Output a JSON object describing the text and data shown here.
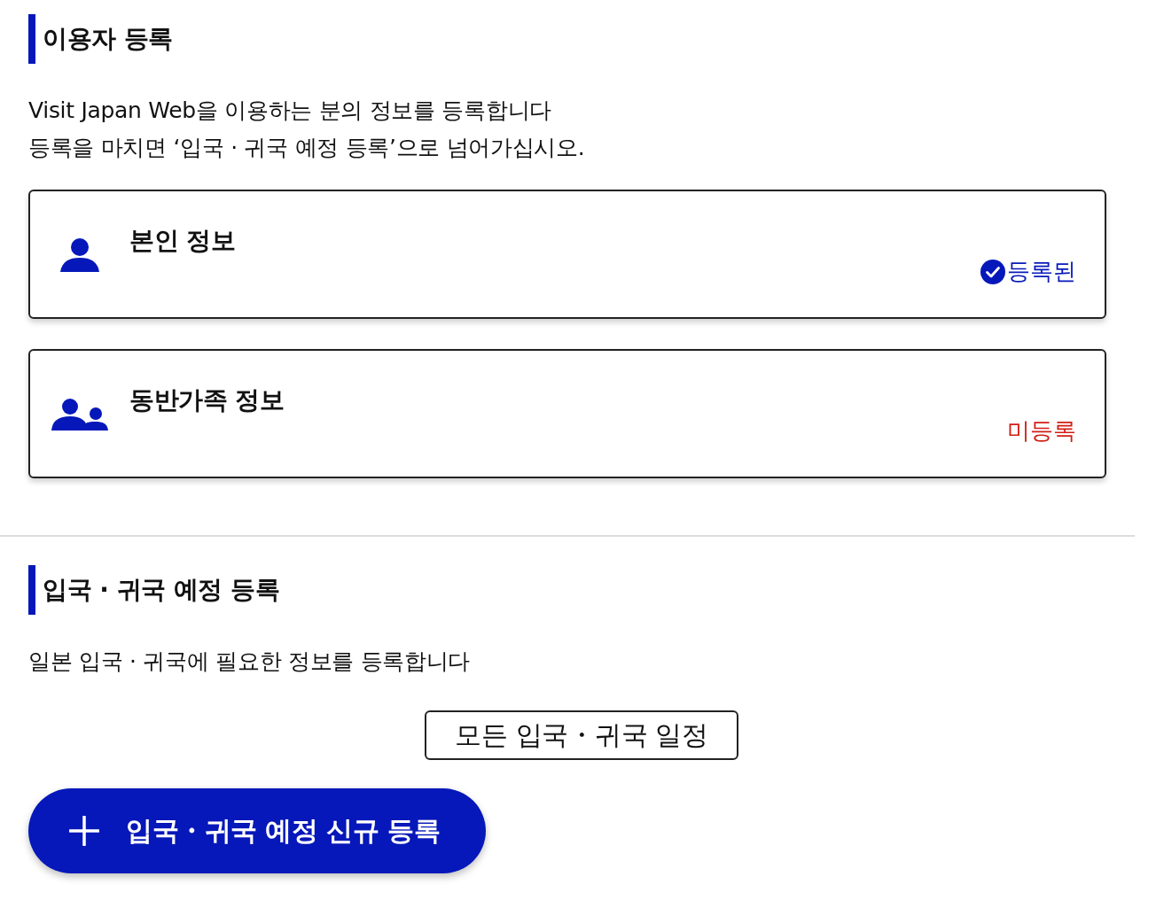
{
  "user_registration": {
    "title": "이용자 등록",
    "description": [
      "Visit Japan Web을 이용하는 분의 정보를 등록합니다",
      "등록을 마치면 ‘입국 · 귀국 예정 등록’으로 넘어가십시오."
    ],
    "cards": [
      {
        "kind": "person",
        "title": "본인 정보",
        "status": "등록된",
        "registered": true
      },
      {
        "kind": "family",
        "title": "동반가족 정보",
        "status": "미등록",
        "registered": false
      }
    ]
  },
  "schedule_registration": {
    "title": "입국 · 귀국 예정 등록",
    "description": [
      "일본 입국 · 귀국에 필요한 정보를 등록합니다"
    ],
    "all_schedules_button": "모든 입국・귀국 일정",
    "new_button": "입국・귀국 예정 신규 등록"
  }
}
